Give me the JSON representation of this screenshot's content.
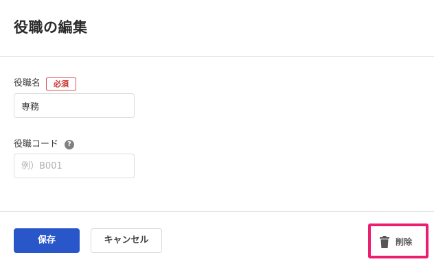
{
  "dialog": {
    "title": "役職の編集"
  },
  "form": {
    "name_field": {
      "label": "役職名",
      "required_badge": "必須",
      "value": "専務"
    },
    "code_field": {
      "label": "役職コード",
      "help_symbol": "?",
      "value": "",
      "placeholder": "例）B001"
    }
  },
  "footer": {
    "save_label": "保存",
    "cancel_label": "キャンセル",
    "delete_label": "削除"
  },
  "colors": {
    "primary": "#2956c9",
    "required": "#c9302c",
    "highlight": "#ec1e6f"
  },
  "icons": {
    "help": "question-circle-icon",
    "delete": "trash-icon"
  }
}
